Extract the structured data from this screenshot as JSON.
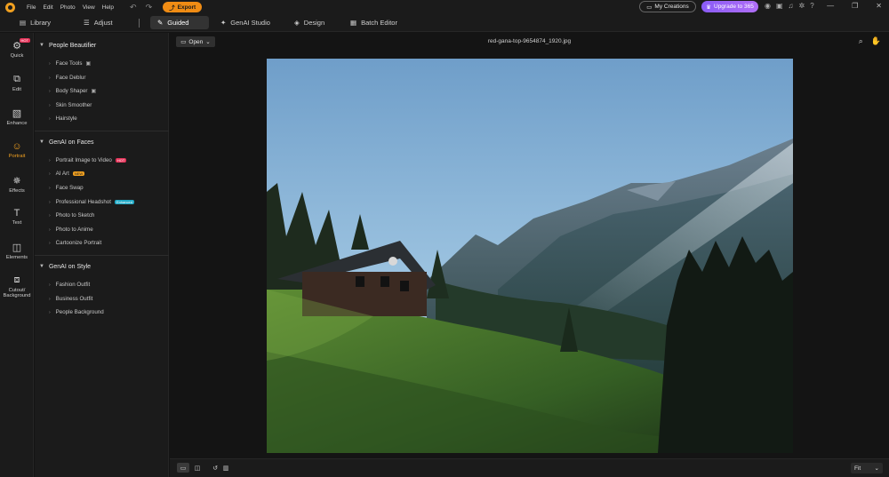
{
  "titlebar": {
    "menu": [
      "File",
      "Edit",
      "Photo",
      "View",
      "Help"
    ],
    "export_label": "Export",
    "my_creations_label": "My Creations",
    "upgrade_label": "Upgrade to 365"
  },
  "modes": {
    "library": "Library",
    "adjust": "Adjust",
    "guided": "Guided",
    "genai_studio": "GenAI Studio",
    "design": "Design",
    "batch_editor": "Batch Editor"
  },
  "rail": {
    "quick": "Quick",
    "quick_badge": "HOT",
    "edit": "Edit",
    "enhance": "Enhance",
    "portrait": "Portrait",
    "effects": "Effects",
    "text": "Text",
    "elements": "Elements",
    "cutout_line1": "Cutout/",
    "cutout_line2": "Background"
  },
  "panel": {
    "sections": [
      {
        "title": "People Beautifier",
        "items": [
          "Face Tools",
          "Face Deblur",
          "Body Shaper",
          "Skin Smoother",
          "Hairstyle"
        ]
      },
      {
        "title": "GenAI on Faces",
        "items": [
          "Portrait Image to Video",
          "AI Art",
          "Face Swap",
          "Professional Headshot",
          "Photo to Sketch",
          "Photo to Anime",
          "Cartoonize Portrait"
        ]
      },
      {
        "title": "GenAI on Style",
        "items": [
          "Fashion Outfit",
          "Business Outfit",
          "People Background"
        ]
      }
    ],
    "tags": {
      "hot": "HOT",
      "new": "NEW",
      "enhanced": "Enhanced"
    }
  },
  "canvas": {
    "open_label": "Open",
    "filename": "red-gana-top-9654874_1920.jpg",
    "zoom": "Fit"
  },
  "colors": {
    "accent": "#f0a020",
    "upgrade": "#9b64f6",
    "export": "#f08c14"
  }
}
